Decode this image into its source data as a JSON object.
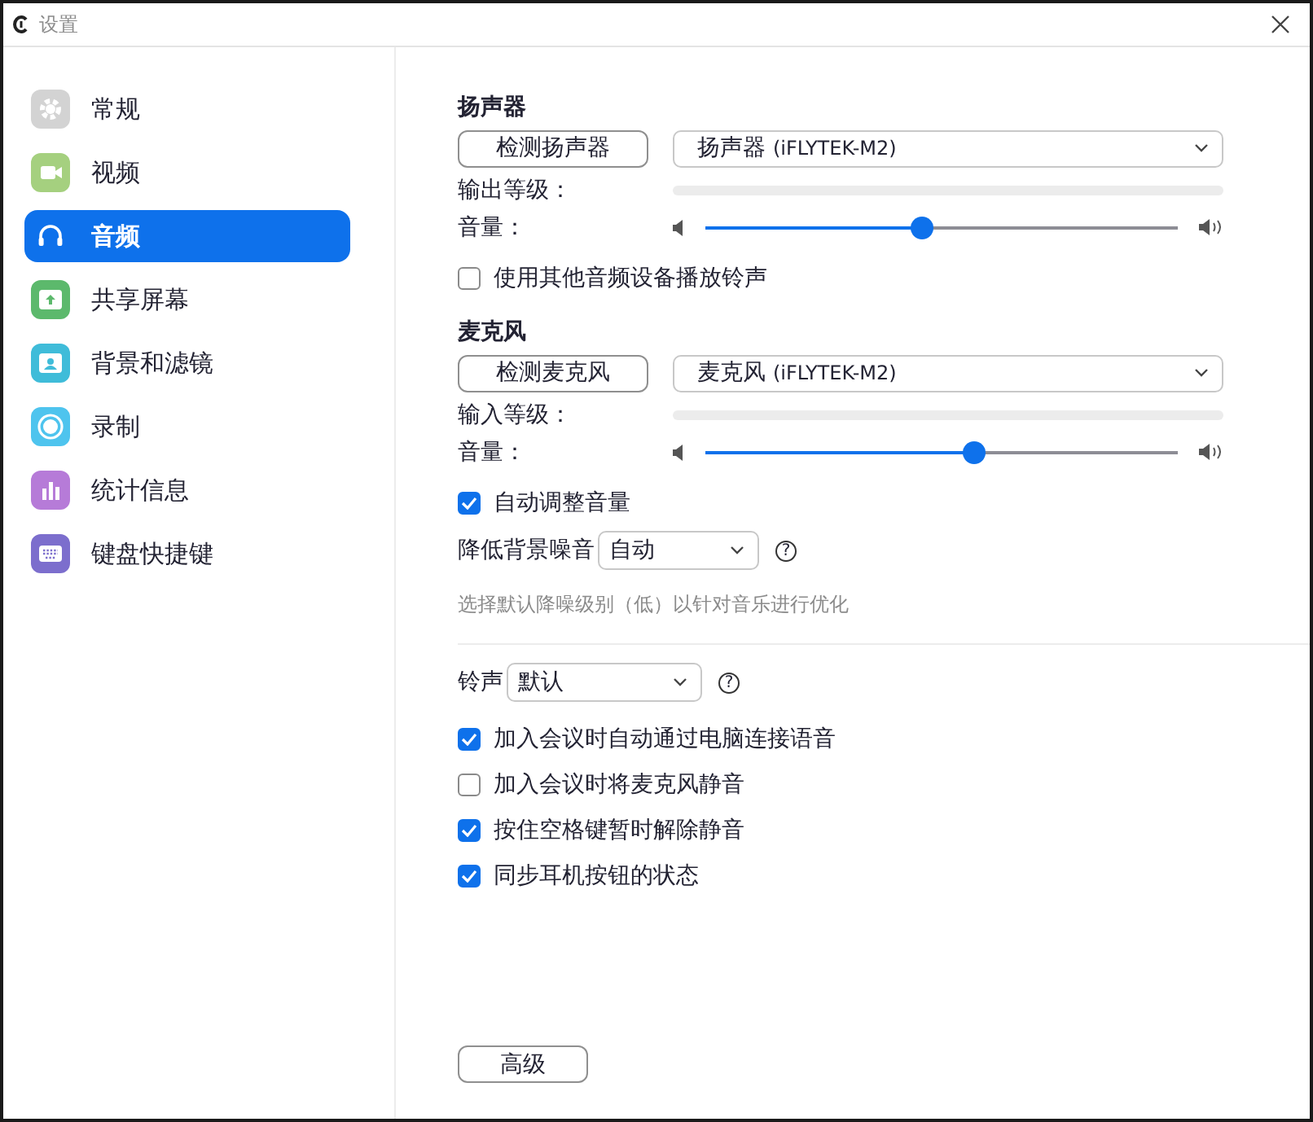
{
  "window": {
    "title": "设置"
  },
  "sidebar": {
    "items": [
      {
        "label": "常规",
        "kind": "gear",
        "selected": false
      },
      {
        "label": "视频",
        "kind": "video",
        "selected": false
      },
      {
        "label": "音频",
        "kind": "headphones",
        "selected": true
      },
      {
        "label": "共享屏幕",
        "kind": "share",
        "selected": false
      },
      {
        "label": "背景和滤镜",
        "kind": "person",
        "selected": false
      },
      {
        "label": "录制",
        "kind": "record",
        "selected": false
      },
      {
        "label": "统计信息",
        "kind": "stats",
        "selected": false
      },
      {
        "label": "键盘快捷键",
        "kind": "keyboard",
        "selected": false
      }
    ]
  },
  "speaker": {
    "heading": "扬声器",
    "test_button": "检测扬声器",
    "device": {
      "name": "扬声器",
      "model": "(iFLYTEK-M2)"
    },
    "meter": {
      "label": "输出等级：",
      "level": 0
    },
    "volume": {
      "label": "音量：",
      "level": 0.46
    },
    "options": [
      {
        "label": "使用其他音频设备播放铃声",
        "checked": false
      }
    ]
  },
  "microphone": {
    "heading": "麦克风",
    "test_button": "检测麦克风",
    "device": {
      "name": "麦克风",
      "model": "(iFLYTEK-M2)"
    },
    "meter": {
      "label": "输入等级：",
      "level": 0
    },
    "volume": {
      "label": "音量：",
      "level": 0.57
    },
    "options": [
      {
        "label": "自动调整音量",
        "checked": true
      }
    ],
    "noise": {
      "label": "降低背景噪音",
      "value": "自动",
      "help": "?",
      "hint": "选择默认降噪级别（低）以针对音乐进行优化"
    }
  },
  "ringtone": {
    "label": "铃声",
    "value": "默认",
    "help": "?"
  },
  "options": [
    {
      "label": "加入会议时自动通过电脑连接语音",
      "checked": true
    },
    {
      "label": "加入会议时将麦克风静音",
      "checked": false
    },
    {
      "label": "按住空格键暂时解除静音",
      "checked": true
    },
    {
      "label": "同步耳机按钮的状态",
      "checked": true
    }
  ],
  "advanced_button": "高级"
}
